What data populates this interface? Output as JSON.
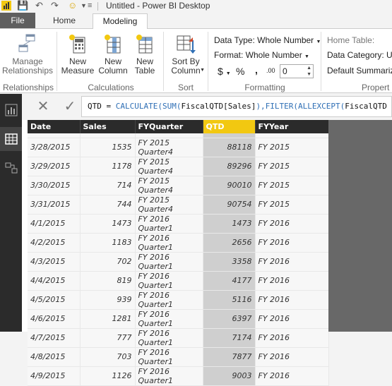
{
  "titlebar": {
    "title": "Untitled - Power BI Desktop"
  },
  "tabs": {
    "file": "File",
    "home": "Home",
    "modeling": "Modeling"
  },
  "ribbon": {
    "manage_relationships": "Manage\nRelationships",
    "new_measure": "New\nMeasure",
    "new_column": "New\nColumn",
    "new_table": "New\nTable",
    "sort_by_column": "Sort By\nColumn",
    "data_type": "Data Type: Whole Number",
    "format": "Format: Whole Number",
    "currency": "$",
    "percent": "%",
    "comma": ",",
    "decimals": ".00",
    "decimal_value": "0",
    "home_table": "Home Table:",
    "data_category": "Data Category: Ur",
    "default_summarization": "Default Summarizat",
    "groups": {
      "relationships": "Relationships",
      "calculations": "Calculations",
      "sort": "Sort",
      "formatting": "Formatting",
      "properties": "Propert"
    }
  },
  "formula": {
    "prefix": "QTD = ",
    "calculate": "CALCULATE(SUM(",
    "arg1": "FiscalQTD[Sales]",
    "mid": "),",
    "filter": "FILTER(ALLEXCEPT(",
    "arg2": "FiscalQTD"
  },
  "table": {
    "columns": [
      "Date",
      "Sales",
      "FYQuarter",
      "QTD",
      "FYYear"
    ],
    "rows": [
      [
        "3/28/2015",
        "1535",
        "FY 2015 Quarter4",
        "88118",
        "FY 2015"
      ],
      [
        "3/29/2015",
        "1178",
        "FY 2015 Quarter4",
        "89296",
        "FY 2015"
      ],
      [
        "3/30/2015",
        "714",
        "FY 2015 Quarter4",
        "90010",
        "FY 2015"
      ],
      [
        "3/31/2015",
        "744",
        "FY 2015 Quarter4",
        "90754",
        "FY 2015"
      ],
      [
        "4/1/2015",
        "1473",
        "FY 2016 Quarter1",
        "1473",
        "FY 2016"
      ],
      [
        "4/2/2015",
        "1183",
        "FY 2016 Quarter1",
        "2656",
        "FY 2016"
      ],
      [
        "4/3/2015",
        "702",
        "FY 2016 Quarter1",
        "3358",
        "FY 2016"
      ],
      [
        "4/4/2015",
        "819",
        "FY 2016 Quarter1",
        "4177",
        "FY 2016"
      ],
      [
        "4/5/2015",
        "939",
        "FY 2016 Quarter1",
        "5116",
        "FY 2016"
      ],
      [
        "4/6/2015",
        "1281",
        "FY 2016 Quarter1",
        "6397",
        "FY 2016"
      ],
      [
        "4/7/2015",
        "777",
        "FY 2016 Quarter1",
        "7174",
        "FY 2016"
      ],
      [
        "4/8/2015",
        "703",
        "FY 2016 Quarter1",
        "7877",
        "FY 2016"
      ],
      [
        "4/9/2015",
        "1126",
        "FY 2016 Quarter1",
        "9003",
        "FY 2016"
      ]
    ]
  },
  "colors": {
    "accent": "#f2c811",
    "file_tab": "#5f5f5f",
    "sidebar": "#2b2b2b",
    "formula_blue": "#2f6fb5"
  }
}
